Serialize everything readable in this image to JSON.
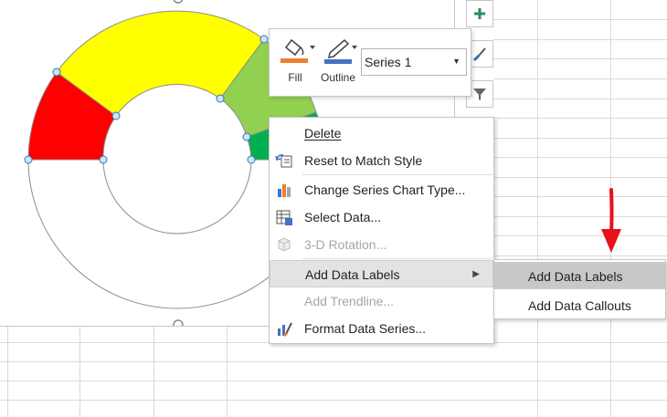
{
  "colors": {
    "segment_red": "#ff0000",
    "segment_yellow": "#ffff00",
    "segment_lightgreen": "#92d050",
    "segment_green": "#00b050",
    "selection_handle": "#4a90d9",
    "arrow_red": "#e8121b",
    "fill_orange": "#ed7d31",
    "outline_blue": "#4472c4"
  },
  "side_buttons": [
    {
      "name": "chart-elements-button",
      "icon": "plus-icon"
    },
    {
      "name": "chart-styles-button",
      "icon": "brush-icon"
    },
    {
      "name": "chart-filters-button",
      "icon": "filter-icon"
    }
  ],
  "mini_toolbar": {
    "fill_label": "Fill",
    "outline_label": "Outline",
    "series_value": "Series 1"
  },
  "context_menu": {
    "items": [
      {
        "label": "Delete",
        "icon": "delete-icon",
        "disabled": false
      },
      {
        "label": "Reset to Match Style",
        "icon": "reset-style-icon",
        "disabled": false
      },
      {
        "label": "Change Series Chart Type...",
        "icon": "chart-type-icon",
        "disabled": false
      },
      {
        "label": "Select Data...",
        "icon": "select-data-icon",
        "disabled": false
      },
      {
        "label": "3-D Rotation...",
        "icon": "rotation-3d-icon",
        "disabled": true
      },
      {
        "label": "Add Data Labels",
        "icon": "",
        "disabled": false,
        "has_submenu": true
      },
      {
        "label": "Add Trendline...",
        "icon": "",
        "disabled": true
      },
      {
        "label": "Format Data Series...",
        "icon": "format-series-icon",
        "disabled": false
      }
    ]
  },
  "submenu": {
    "items": [
      {
        "label": "Add Data Labels",
        "active": true
      },
      {
        "label": "Add Data Callouts",
        "active": false
      }
    ]
  }
}
